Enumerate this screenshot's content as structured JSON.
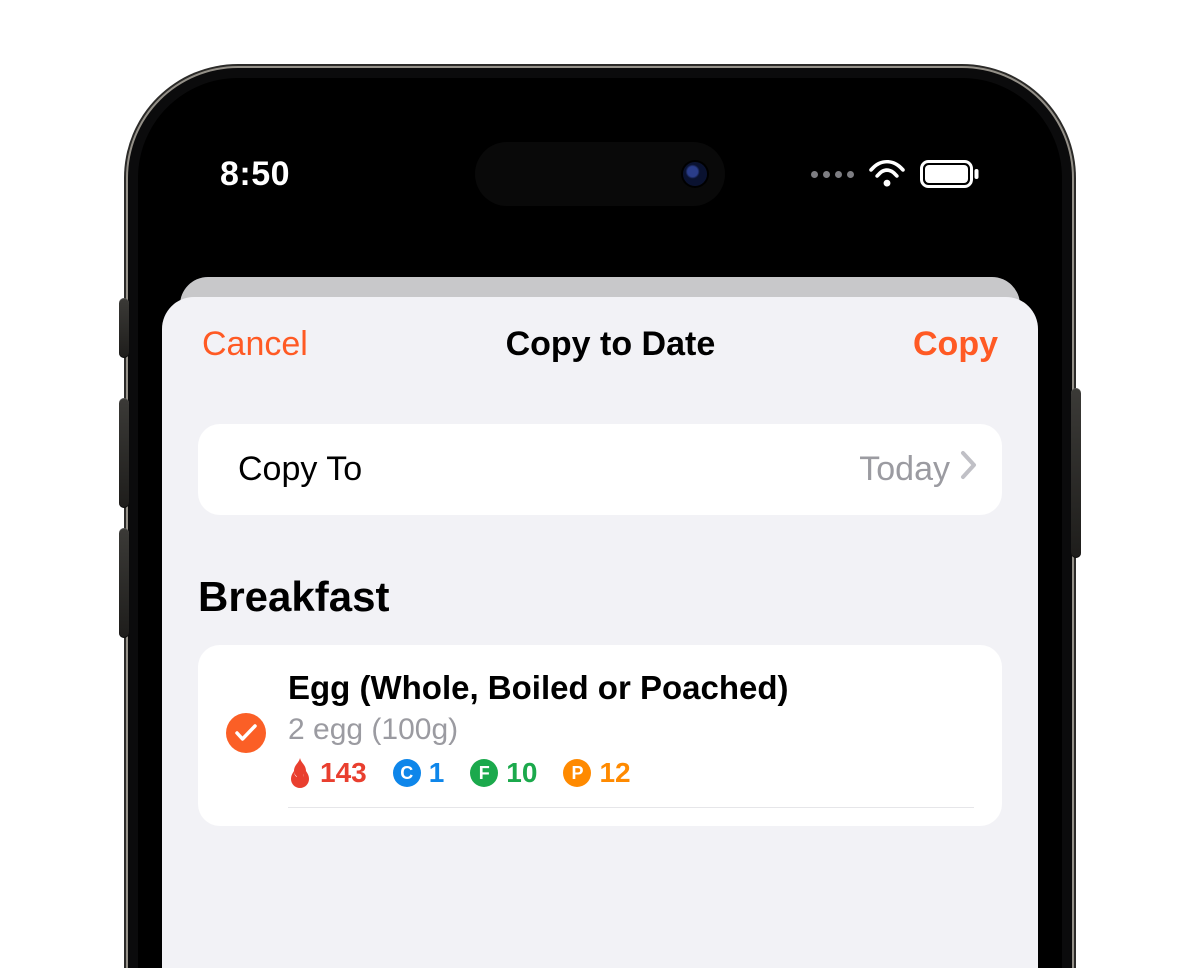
{
  "status": {
    "time": "8:50"
  },
  "nav": {
    "cancel": "Cancel",
    "title": "Copy to Date",
    "copy": "Copy"
  },
  "copy_to": {
    "label": "Copy To",
    "value": "Today"
  },
  "section": {
    "title": "Breakfast"
  },
  "item": {
    "title": "Egg (Whole, Boiled or Poached)",
    "subtitle": "2 egg (100g)",
    "calories": "143",
    "c_badge": "C",
    "carbs": "1",
    "f_badge": "F",
    "fat": "10",
    "p_badge": "P",
    "protein": "12"
  }
}
